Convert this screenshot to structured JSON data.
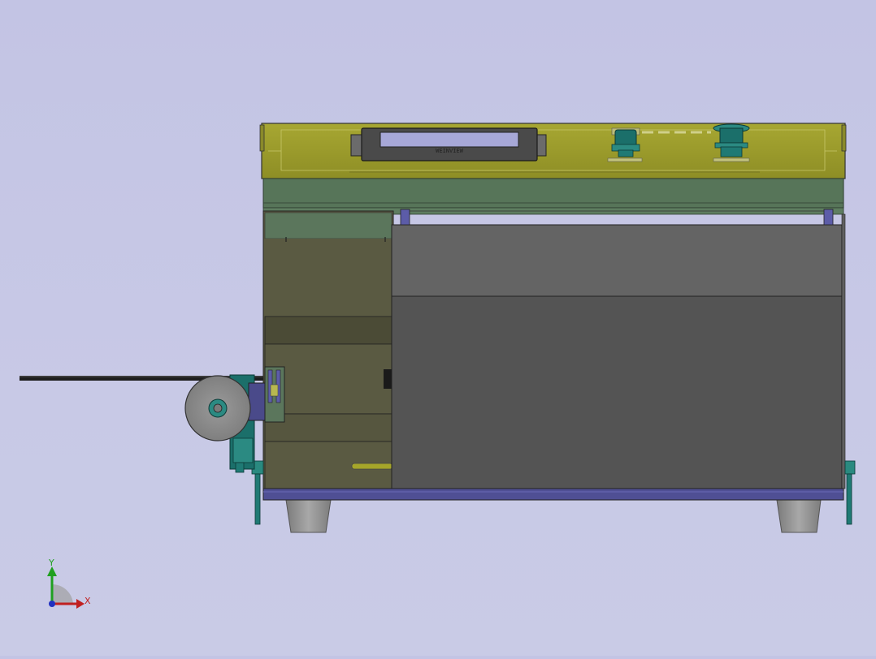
{
  "viewport": {
    "background": "#c6c7e5"
  },
  "model": {
    "description_colors": {
      "control_panel": "#9d9d2b",
      "body_frame": "#55715a",
      "steel_panel": "#5a5a5a",
      "blue_rail": "#4a4a8e",
      "teal_parts": "#1f7a74",
      "legs": "#8f8f8f"
    },
    "display_text": "WEINVIEW"
  },
  "triad": {
    "x_label": "X",
    "y_label": "Y",
    "x_color": "#c02020",
    "y_color": "#20a020",
    "z_color": "#2030c0"
  }
}
